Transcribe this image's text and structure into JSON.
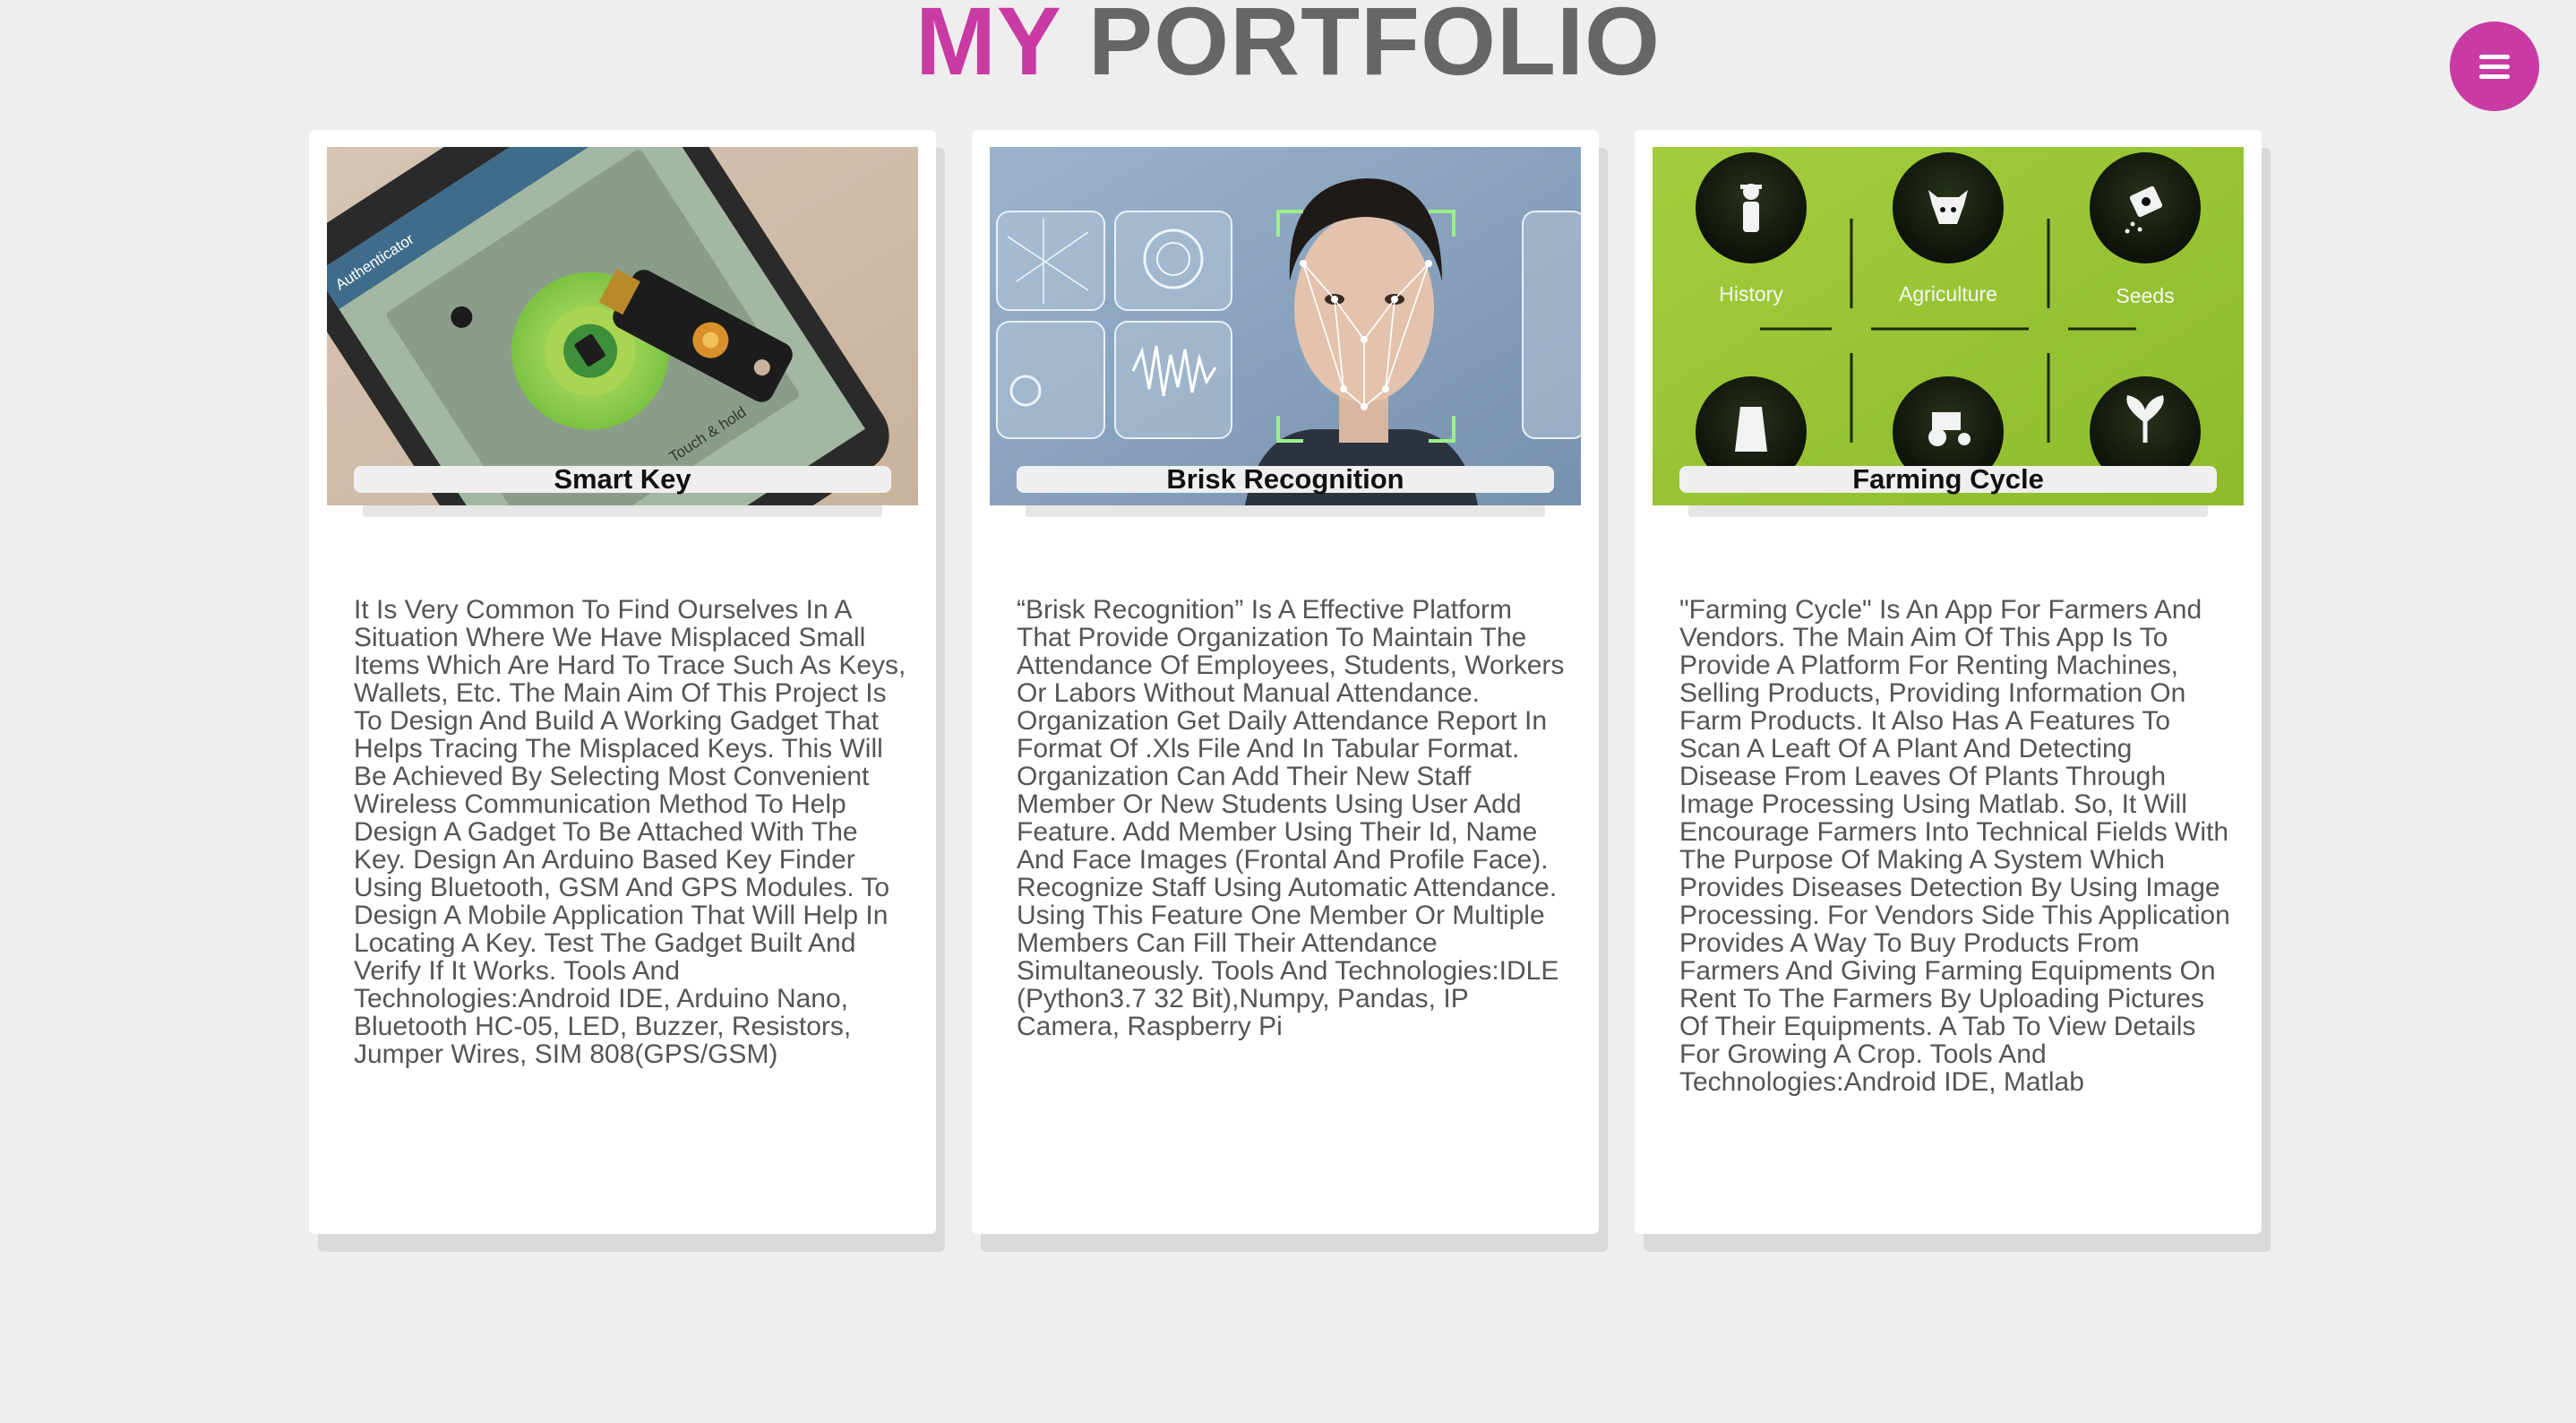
{
  "header": {
    "title_accent": "MY",
    "title_rest": "PORTFOLIO"
  },
  "menu": {
    "icon": "hamburger-menu-icon",
    "color": "#c93aa3"
  },
  "colors": {
    "accent": "#c93aa3",
    "title_gray": "#666666",
    "background": "#eeeeee",
    "card": "#ffffff",
    "text": "#555555"
  },
  "projects": [
    {
      "title": "Smart Key",
      "image": {
        "phone_screen_label": "Authenticator",
        "instruction": "Touch & hold"
      },
      "description": "It Is Very Common To Find Ourselves In A Situation Where We Have Misplaced Small Items Which Are Hard To Trace Such As Keys, Wallets, Etc. The Main Aim Of This Project Is To Design And Build A Working Gadget That Helps Tracing The Misplaced Keys. This Will Be Achieved By Selecting Most Convenient Wireless Communication Method To Help Design A Gadget To Be Attached With The Key. Design An Arduino Based Key Finder Using Bluetooth, GSM And GPS Modules. To Design A Mobile Application That Will Help In Locating A Key. Test The Gadget Built And Verify If It Works. Tools And Technologies:Android IDE, Arduino Nano, Bluetooth HC-05, LED, Buzzer, Resistors, Jumper Wires, SIM 808(GPS/GSM)"
    },
    {
      "title": "Brisk Recognition",
      "description": "“Brisk Recognition” Is A Effective Platform That Provide Organization To Maintain The Attendance Of Employees, Students, Workers Or Labors Without Manual Attendance. Organization Get Daily Attendance Report In Format Of .Xls File And In Tabular Format. Organization Can Add Their New Staff Member Or New Students Using User Add Feature. Add Member Using Their Id, Name And Face Images (Frontal And Profile Face). Recognize Staff Using Automatic Attendance. Using This Feature One Member Or Multiple Members Can Fill Their Attendance Simultaneously. Tools And Technologies:IDLE (Python3.7 32 Bit),Numpy, Pandas, IP Camera, Raspberry Pi"
    },
    {
      "title": "Farming Cycle",
      "image": {
        "labels": [
          "History",
          "Agriculture",
          "Seeds"
        ]
      },
      "description": "\"Farming Cycle\" Is An App For Farmers And Vendors. The Main Aim Of This App Is To Provide A Platform For Renting Machines, Selling Products, Providing Information On Farm Products. It Also Has A Features To Scan A Leaft Of A Plant And Detecting Disease From Leaves Of Plants Through Image Processing Using Matlab. So, It Will Encourage Farmers Into Technical Fields With The Purpose Of Making A System Which Provides Diseases Detection By Using Image Processing. For Vendors Side This Application Provides A Way To Buy Products From Farmers And Giving Farming Equipments On Rent To The Farmers By Uploading Pictures Of Their Equipments. A Tab To View Details For Growing A Crop. Tools And Technologies:Android IDE, Matlab"
    }
  ]
}
